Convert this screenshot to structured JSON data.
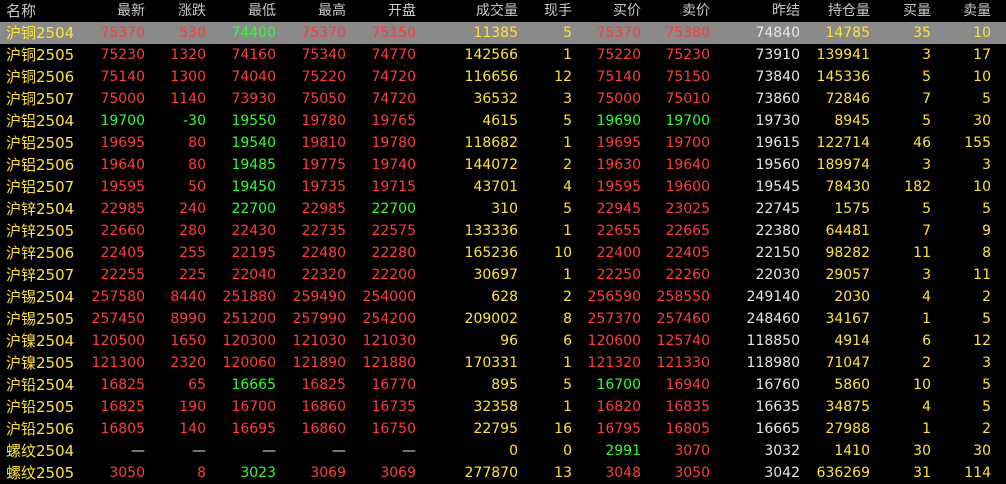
{
  "colors": {
    "up": "#ff3c3c",
    "down": "#2cff2c",
    "flat": "#e6e6e6",
    "volume": "#ffe23a",
    "selected_bg": "#8a8a8a"
  },
  "headers": [
    "名称",
    "最新",
    "涨跌",
    "最低",
    "最高",
    "开盘",
    "成交量",
    "现手",
    "买价",
    "卖价",
    "昨结",
    "持仓量",
    "买量",
    "卖量"
  ],
  "selected_index": 0,
  "rows": [
    {
      "name": "沪铜2504",
      "last": "75370",
      "chg": "530",
      "low": "74400",
      "high": "75370",
      "open": "75150",
      "vol": "11385",
      "cur": "5",
      "bid": "75370",
      "ask": "75380",
      "prev": "74840",
      "oi": "14785",
      "bidv": "35",
      "askv": "10",
      "colors": {
        "last": "red",
        "chg": "red",
        "low": "green",
        "high": "red",
        "open": "red",
        "bid": "red",
        "ask": "red"
      }
    },
    {
      "name": "沪铜2505",
      "last": "75230",
      "chg": "1320",
      "low": "74160",
      "high": "75340",
      "open": "74770",
      "vol": "142566",
      "cur": "1",
      "bid": "75220",
      "ask": "75230",
      "prev": "73910",
      "oi": "139941",
      "bidv": "3",
      "askv": "17",
      "colors": {
        "last": "red",
        "chg": "red",
        "low": "red",
        "high": "red",
        "open": "red",
        "bid": "red",
        "ask": "red"
      }
    },
    {
      "name": "沪铜2506",
      "last": "75140",
      "chg": "1300",
      "low": "74040",
      "high": "75220",
      "open": "74720",
      "vol": "116656",
      "cur": "12",
      "bid": "75140",
      "ask": "75150",
      "prev": "73840",
      "oi": "145336",
      "bidv": "5",
      "askv": "10",
      "colors": {
        "last": "red",
        "chg": "red",
        "low": "red",
        "high": "red",
        "open": "red",
        "bid": "red",
        "ask": "red"
      }
    },
    {
      "name": "沪铜2507",
      "last": "75000",
      "chg": "1140",
      "low": "73930",
      "high": "75050",
      "open": "74720",
      "vol": "36532",
      "cur": "3",
      "bid": "75000",
      "ask": "75010",
      "prev": "73860",
      "oi": "72846",
      "bidv": "7",
      "askv": "5",
      "colors": {
        "last": "red",
        "chg": "red",
        "low": "red",
        "high": "red",
        "open": "red",
        "bid": "red",
        "ask": "red"
      }
    },
    {
      "name": "沪铝2504",
      "last": "19700",
      "chg": "-30",
      "low": "19550",
      "high": "19780",
      "open": "19765",
      "vol": "4615",
      "cur": "5",
      "bid": "19690",
      "ask": "19700",
      "prev": "19730",
      "oi": "8945",
      "bidv": "5",
      "askv": "30",
      "colors": {
        "last": "green",
        "chg": "green",
        "low": "green",
        "high": "red",
        "open": "red",
        "bid": "green",
        "ask": "green"
      }
    },
    {
      "name": "沪铝2505",
      "last": "19695",
      "chg": "80",
      "low": "19540",
      "high": "19810",
      "open": "19780",
      "vol": "118682",
      "cur": "1",
      "bid": "19695",
      "ask": "19700",
      "prev": "19615",
      "oi": "122714",
      "bidv": "46",
      "askv": "155",
      "colors": {
        "last": "red",
        "chg": "red",
        "low": "green",
        "high": "red",
        "open": "red",
        "bid": "red",
        "ask": "red"
      }
    },
    {
      "name": "沪铝2506",
      "last": "19640",
      "chg": "80",
      "low": "19485",
      "high": "19775",
      "open": "19740",
      "vol": "144072",
      "cur": "2",
      "bid": "19630",
      "ask": "19640",
      "prev": "19560",
      "oi": "189974",
      "bidv": "3",
      "askv": "3",
      "colors": {
        "last": "red",
        "chg": "red",
        "low": "green",
        "high": "red",
        "open": "red",
        "bid": "red",
        "ask": "red"
      }
    },
    {
      "name": "沪铝2507",
      "last": "19595",
      "chg": "50",
      "low": "19450",
      "high": "19735",
      "open": "19715",
      "vol": "43701",
      "cur": "4",
      "bid": "19595",
      "ask": "19600",
      "prev": "19545",
      "oi": "78430",
      "bidv": "182",
      "askv": "10",
      "colors": {
        "last": "red",
        "chg": "red",
        "low": "green",
        "high": "red",
        "open": "red",
        "bid": "red",
        "ask": "red"
      }
    },
    {
      "name": "沪锌2504",
      "last": "22985",
      "chg": "240",
      "low": "22700",
      "high": "22985",
      "open": "22700",
      "vol": "310",
      "cur": "5",
      "bid": "22945",
      "ask": "23025",
      "prev": "22745",
      "oi": "1575",
      "bidv": "5",
      "askv": "5",
      "colors": {
        "last": "red",
        "chg": "red",
        "low": "green",
        "high": "red",
        "open": "green",
        "bid": "red",
        "ask": "red"
      }
    },
    {
      "name": "沪锌2505",
      "last": "22660",
      "chg": "280",
      "low": "22430",
      "high": "22735",
      "open": "22575",
      "vol": "133336",
      "cur": "1",
      "bid": "22655",
      "ask": "22665",
      "prev": "22380",
      "oi": "64481",
      "bidv": "7",
      "askv": "9",
      "colors": {
        "last": "red",
        "chg": "red",
        "low": "red",
        "high": "red",
        "open": "red",
        "bid": "red",
        "ask": "red"
      }
    },
    {
      "name": "沪锌2506",
      "last": "22405",
      "chg": "255",
      "low": "22195",
      "high": "22480",
      "open": "22280",
      "vol": "165236",
      "cur": "10",
      "bid": "22400",
      "ask": "22405",
      "prev": "22150",
      "oi": "98282",
      "bidv": "11",
      "askv": "8",
      "colors": {
        "last": "red",
        "chg": "red",
        "low": "red",
        "high": "red",
        "open": "red",
        "bid": "red",
        "ask": "red"
      }
    },
    {
      "name": "沪锌2507",
      "last": "22255",
      "chg": "225",
      "low": "22040",
      "high": "22320",
      "open": "22200",
      "vol": "30697",
      "cur": "1",
      "bid": "22250",
      "ask": "22260",
      "prev": "22030",
      "oi": "29057",
      "bidv": "3",
      "askv": "11",
      "colors": {
        "last": "red",
        "chg": "red",
        "low": "red",
        "high": "red",
        "open": "red",
        "bid": "red",
        "ask": "red"
      }
    },
    {
      "name": "沪锡2504",
      "last": "257580",
      "chg": "8440",
      "low": "251880",
      "high": "259490",
      "open": "254000",
      "vol": "628",
      "cur": "2",
      "bid": "256590",
      "ask": "258550",
      "prev": "249140",
      "oi": "2030",
      "bidv": "4",
      "askv": "2",
      "colors": {
        "last": "red",
        "chg": "red",
        "low": "red",
        "high": "red",
        "open": "red",
        "bid": "red",
        "ask": "red"
      }
    },
    {
      "name": "沪锡2505",
      "last": "257450",
      "chg": "8990",
      "low": "251200",
      "high": "257990",
      "open": "254200",
      "vol": "209002",
      "cur": "8",
      "bid": "257370",
      "ask": "257460",
      "prev": "248460",
      "oi": "34167",
      "bidv": "1",
      "askv": "5",
      "colors": {
        "last": "red",
        "chg": "red",
        "low": "red",
        "high": "red",
        "open": "red",
        "bid": "red",
        "ask": "red"
      }
    },
    {
      "name": "沪镍2504",
      "last": "120500",
      "chg": "1650",
      "low": "120300",
      "high": "121030",
      "open": "121030",
      "vol": "96",
      "cur": "6",
      "bid": "120600",
      "ask": "125740",
      "prev": "118850",
      "oi": "4914",
      "bidv": "6",
      "askv": "12",
      "colors": {
        "last": "red",
        "chg": "red",
        "low": "red",
        "high": "red",
        "open": "red",
        "bid": "red",
        "ask": "red"
      }
    },
    {
      "name": "沪镍2505",
      "last": "121300",
      "chg": "2320",
      "low": "120060",
      "high": "121890",
      "open": "121880",
      "vol": "170331",
      "cur": "1",
      "bid": "121320",
      "ask": "121330",
      "prev": "118980",
      "oi": "71047",
      "bidv": "2",
      "askv": "3",
      "colors": {
        "last": "red",
        "chg": "red",
        "low": "red",
        "high": "red",
        "open": "red",
        "bid": "red",
        "ask": "red"
      }
    },
    {
      "name": "沪铅2504",
      "last": "16825",
      "chg": "65",
      "low": "16665",
      "high": "16825",
      "open": "16770",
      "vol": "895",
      "cur": "5",
      "bid": "16700",
      "ask": "16940",
      "prev": "16760",
      "oi": "5860",
      "bidv": "10",
      "askv": "5",
      "colors": {
        "last": "red",
        "chg": "red",
        "low": "green",
        "high": "red",
        "open": "red",
        "bid": "green",
        "ask": "red"
      }
    },
    {
      "name": "沪铅2505",
      "last": "16825",
      "chg": "190",
      "low": "16700",
      "high": "16860",
      "open": "16735",
      "vol": "32358",
      "cur": "1",
      "bid": "16820",
      "ask": "16835",
      "prev": "16635",
      "oi": "34875",
      "bidv": "4",
      "askv": "5",
      "colors": {
        "last": "red",
        "chg": "red",
        "low": "red",
        "high": "red",
        "open": "red",
        "bid": "red",
        "ask": "red"
      }
    },
    {
      "name": "沪铅2506",
      "last": "16805",
      "chg": "140",
      "low": "16695",
      "high": "16860",
      "open": "16750",
      "vol": "22795",
      "cur": "16",
      "bid": "16795",
      "ask": "16805",
      "prev": "16665",
      "oi": "27988",
      "bidv": "1",
      "askv": "2",
      "colors": {
        "last": "red",
        "chg": "red",
        "low": "red",
        "high": "red",
        "open": "red",
        "bid": "red",
        "ask": "red"
      }
    },
    {
      "name": "螺纹2504",
      "last": "—",
      "chg": "—",
      "low": "—",
      "high": "—",
      "open": "—",
      "vol": "0",
      "cur": "0",
      "bid": "2991",
      "ask": "3070",
      "prev": "3032",
      "oi": "1410",
      "bidv": "30",
      "askv": "30",
      "colors": {
        "last": "white",
        "chg": "white",
        "low": "white",
        "high": "white",
        "open": "white",
        "bid": "green",
        "ask": "red"
      }
    },
    {
      "name": "螺纹2505",
      "last": "3050",
      "chg": "8",
      "low": "3023",
      "high": "3069",
      "open": "3069",
      "vol": "277870",
      "cur": "13",
      "bid": "3048",
      "ask": "3050",
      "prev": "3042",
      "oi": "636269",
      "bidv": "31",
      "askv": "114",
      "colors": {
        "last": "red",
        "chg": "red",
        "low": "green",
        "high": "red",
        "open": "red",
        "bid": "red",
        "ask": "red"
      }
    }
  ]
}
